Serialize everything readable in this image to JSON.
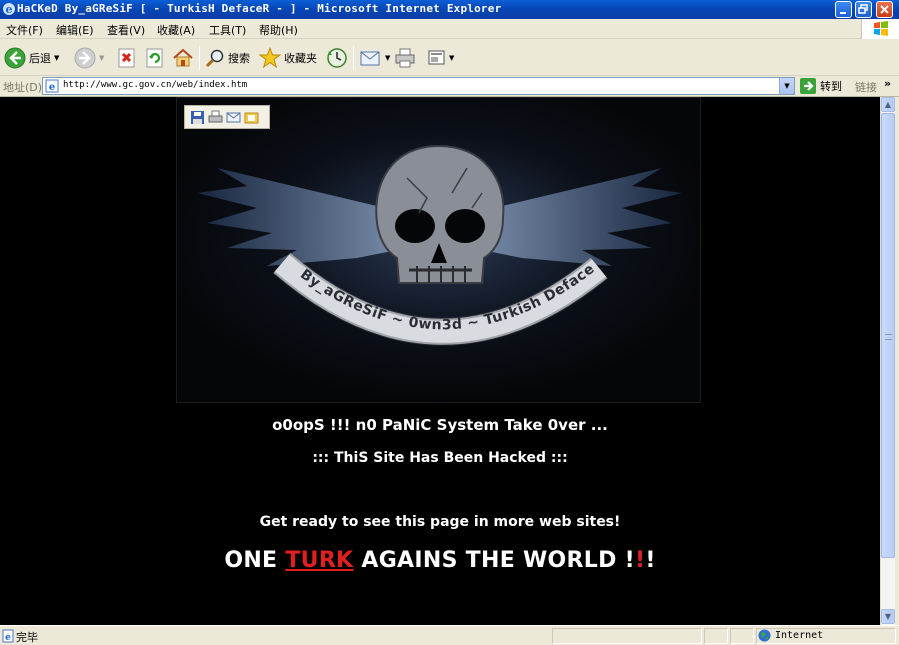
{
  "window": {
    "title": "HaCKeD By_aGReSiF [ - TurkisH DefaceR - ] - Microsoft Internet Explorer"
  },
  "menu": [
    "文件(F)",
    "编辑(E)",
    "查看(V)",
    "收藏(A)",
    "工具(T)",
    "帮助(H)"
  ],
  "toolbar": {
    "back_label": "后退",
    "search_label": "搜索",
    "favorites_label": "收藏夹"
  },
  "address": {
    "label": "地址(D)",
    "url": "http://www.gc.gov.cn/web/index.htm",
    "go_label": "转到",
    "links_label": "链接"
  },
  "page": {
    "banner_text": "By_aGReSiF ~ 0wn3d ~ Turkish Defacer",
    "line1": "o0opS !!! n0 PaNiC  System Take 0ver ...",
    "line2": "::: ThiS Site Has Been Hacked :::",
    "line3": "Get ready to see this page in more web sites!",
    "line4_a": "ONE ",
    "line4_turk": "TURK",
    "line4_b": " AGAINS THE WORLD !",
    "line4_red": "!",
    "line4_c": "!"
  },
  "status": {
    "text": "完毕",
    "zone": "Internet"
  },
  "colors": {
    "title_bar": "#0a4fc4",
    "page_bg": "#000000",
    "accent_red": "#e02020"
  }
}
